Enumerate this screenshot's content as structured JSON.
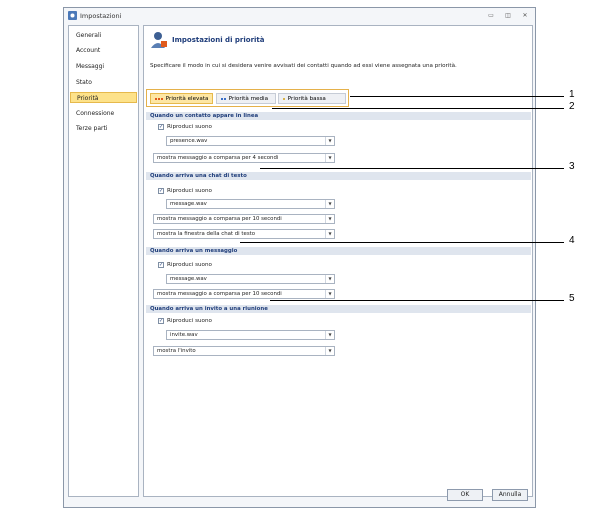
{
  "window": {
    "title": "Impostazioni",
    "title_icon": "settings-app-icon",
    "controls": [
      "minimize-icon",
      "restore-icon",
      "close-icon"
    ]
  },
  "sidebar": {
    "items": [
      {
        "label": "Generali"
      },
      {
        "label": "Account"
      },
      {
        "label": "Messaggi"
      },
      {
        "label": "Stato"
      },
      {
        "label": "Priorità",
        "selected": true
      },
      {
        "label": "Connessione"
      },
      {
        "label": "Terze parti"
      }
    ]
  },
  "header": {
    "title": "Impostazioni di priorità",
    "description": "Specificare il modo in cui si desidera venire avvisati dei contatti quando ad essi viene assegnata una priorità."
  },
  "tabs": [
    {
      "label": "Priorità elevata",
      "active": true,
      "dot_color": "#e05a1c"
    },
    {
      "label": "Priorità media",
      "active": false,
      "dot_color": "#3a6fc7"
    },
    {
      "label": "Priorità bassa",
      "active": false,
      "dot_color": "#d9b44a"
    }
  ],
  "sections": [
    {
      "title": "Quando un contatto appare in linea",
      "checkbox_label": "Riproduci suono",
      "checked": true,
      "sound": "presence.wav",
      "combos": [
        "mostra messaggio a comparsa per 4 secondi"
      ]
    },
    {
      "title": "Quando arriva una chat di testo",
      "checkbox_label": "Riproduci suono",
      "checked": true,
      "sound": "message.wav",
      "combos": [
        "mostra messaggio a comparsa per 10 secondi",
        "mostra la finestra della chat di testo"
      ]
    },
    {
      "title": "Quando arriva un messaggio",
      "checkbox_label": "Riproduci suono",
      "checked": true,
      "sound": "message.wav",
      "combos": [
        "mostra messaggio a comparsa per 10 secondi"
      ]
    },
    {
      "title": "Quando arriva un invito a una riunione",
      "checkbox_label": "Riproduci suono",
      "checked": true,
      "sound": "invite.wav",
      "combos": [
        "mostra l'invito"
      ]
    }
  ],
  "footer": {
    "ok_label": "OK",
    "cancel_label": "Annulla"
  },
  "callouts": [
    "1",
    "2",
    "3",
    "4",
    "5"
  ]
}
